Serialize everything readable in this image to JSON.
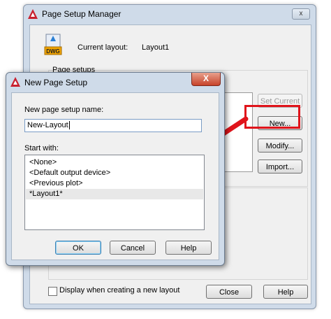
{
  "manager": {
    "title": "Page Setup Manager",
    "close_glyph": "x",
    "current_layout_label": "Current layout:",
    "current_layout_value": "Layout1",
    "page_setups_label": "Page setups",
    "set_current_label": "Set Current",
    "new_label": "New...",
    "modify_label": "Modify...",
    "import_label": "Import...",
    "display_checkbox_label": "Display when creating a new layout",
    "display_checked": false,
    "close_button_label": "Close",
    "help_button_label": "Help",
    "dwg_icon_text": "DWG"
  },
  "dialog": {
    "title": "New Page Setup",
    "close_glyph": "X",
    "name_label": "New page setup name:",
    "name_value": "New-Layout",
    "start_with_label": "Start with:",
    "start_items": [
      "<None>",
      "<Default output device>",
      "<Previous plot>",
      "*Layout1*"
    ],
    "selected_index": 3,
    "ok_label": "OK",
    "cancel_label": "Cancel",
    "help_label": "Help"
  },
  "colors": {
    "highlight": "#e0141b",
    "frame": "#cfdbe9",
    "app_red": "#c8202f"
  }
}
